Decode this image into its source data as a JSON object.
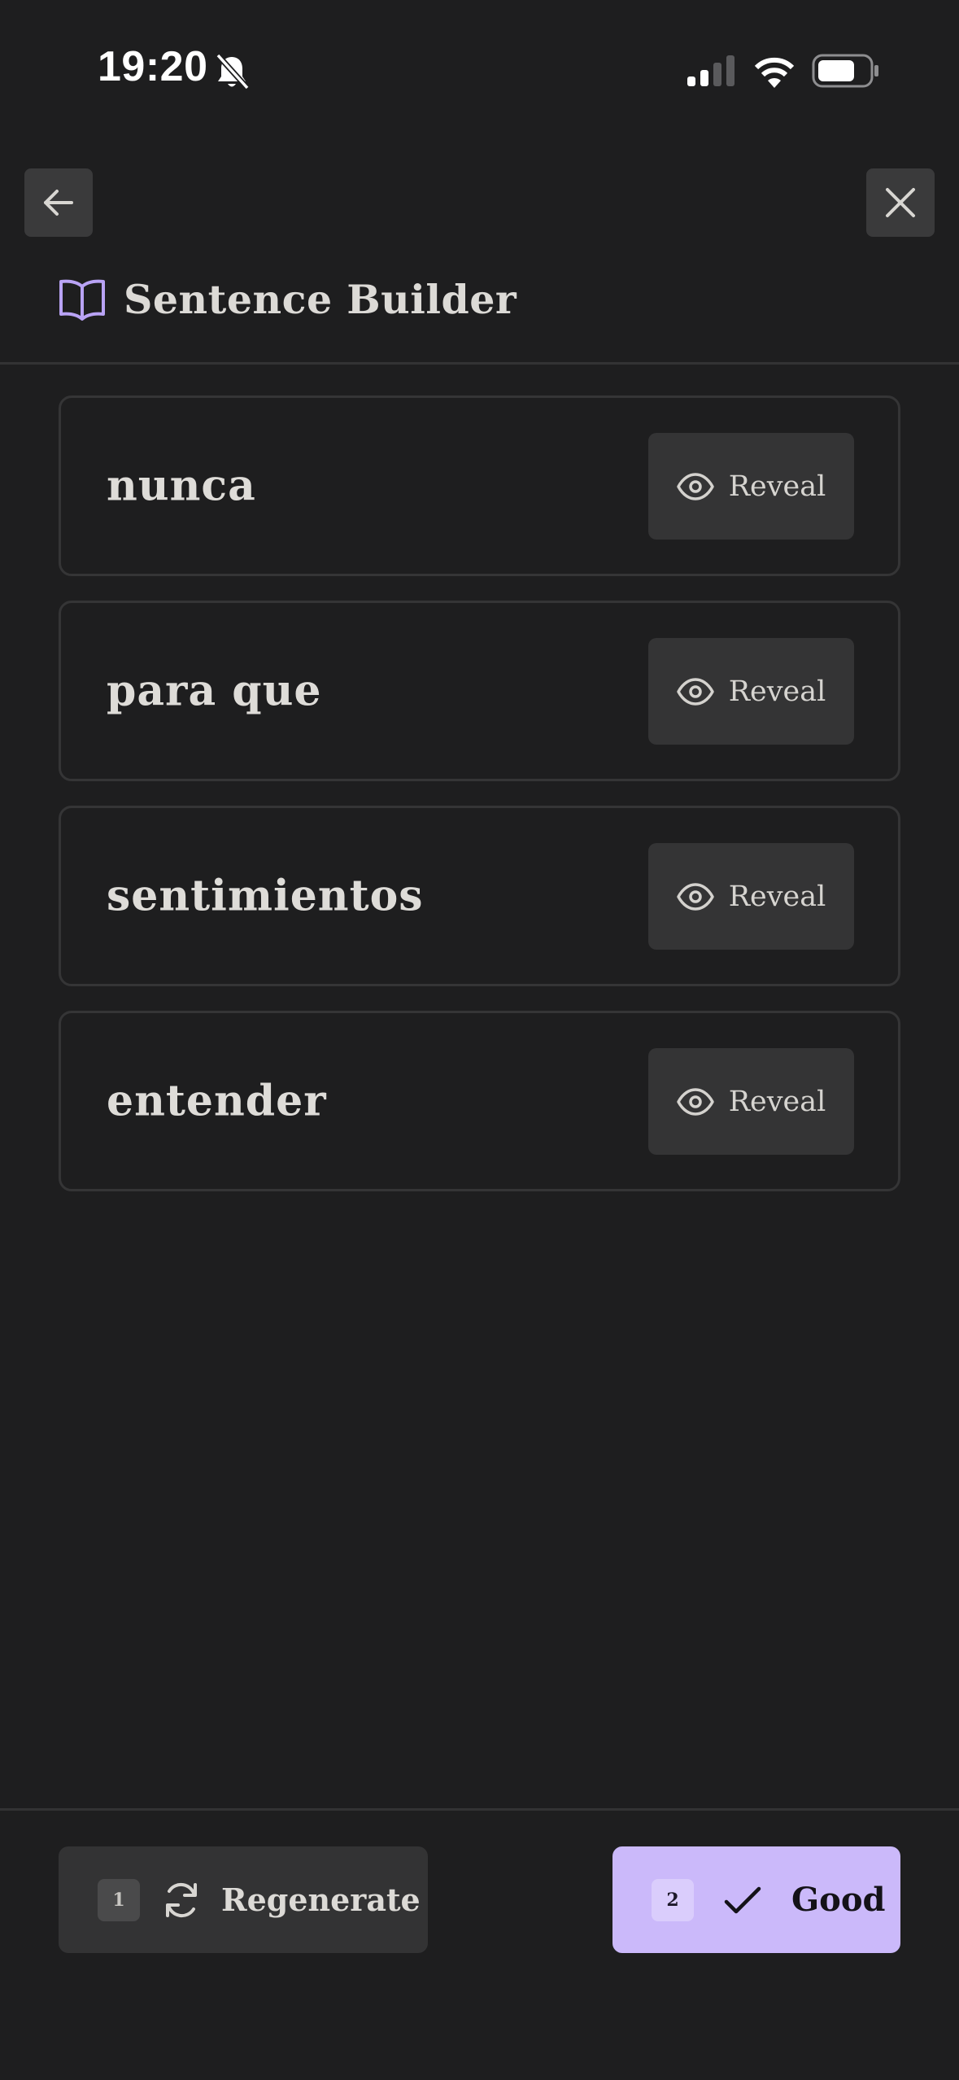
{
  "status_bar": {
    "time": "19:20",
    "icons": [
      "bell-slash-icon",
      "cellular-signal-icon",
      "wifi-icon",
      "battery-icon"
    ]
  },
  "nav": {
    "back_icon": "arrow-left-icon",
    "close_icon": "close-icon"
  },
  "header": {
    "icon": "book-open-icon",
    "title": "Sentence Builder"
  },
  "words": [
    {
      "word": "nunca",
      "action_label": "Reveal",
      "action_icon": "eye-icon"
    },
    {
      "word": "para que",
      "action_label": "Reveal",
      "action_icon": "eye-icon"
    },
    {
      "word": "sentimientos",
      "action_label": "Reveal",
      "action_icon": "eye-icon"
    },
    {
      "word": "entender",
      "action_label": "Reveal",
      "action_icon": "eye-icon"
    }
  ],
  "footer": {
    "regenerate": {
      "shortcut": "1",
      "label": "Regenerate",
      "icon": "refresh-icon"
    },
    "good": {
      "shortcut": "2",
      "label": "Good",
      "icon": "check-icon"
    }
  },
  "colors": {
    "background": "#1e1e1f",
    "accent": "#cbb9fa",
    "card_border": "#353536",
    "button_bg": "#343435"
  }
}
